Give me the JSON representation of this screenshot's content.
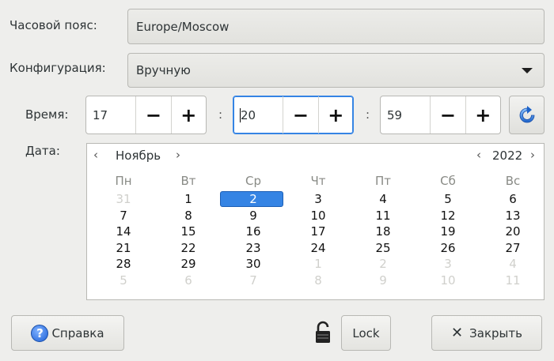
{
  "timezone": {
    "label": "Часовой пояс:",
    "value": "Europe/Moscow"
  },
  "config": {
    "label": "Конфигурация:",
    "value": "Вручную"
  },
  "time": {
    "label": "Время:",
    "hours": "17",
    "minutes": "20",
    "seconds": "59",
    "separator": ":",
    "minus": "−",
    "plus": "+"
  },
  "date": {
    "label": "Дата:",
    "month": "Ноябрь",
    "year": "2022",
    "prev": "‹",
    "next": "›",
    "weekdays": [
      "Пн",
      "Вт",
      "Ср",
      "Чт",
      "Пт",
      "Сб",
      "Вс"
    ],
    "weeks": [
      [
        "31",
        "1",
        "2",
        "3",
        "4",
        "5",
        "6"
      ],
      [
        "7",
        "8",
        "9",
        "10",
        "11",
        "12",
        "13"
      ],
      [
        "14",
        "15",
        "16",
        "17",
        "18",
        "19",
        "20"
      ],
      [
        "21",
        "22",
        "23",
        "24",
        "25",
        "26",
        "27"
      ],
      [
        "28",
        "29",
        "30",
        "1",
        "2",
        "3",
        "4"
      ],
      [
        "5",
        "6",
        "7",
        "8",
        "9",
        "10",
        "11"
      ]
    ],
    "selected_day": "2"
  },
  "buttons": {
    "help": "Справка",
    "lock": "Lock",
    "close": "Закрыть"
  },
  "icons": {
    "help": "help-icon",
    "lock": "padlock-icon",
    "close": "x-icon",
    "refresh": "refresh-icon"
  },
  "colors": {
    "accent": "#3584e4"
  }
}
